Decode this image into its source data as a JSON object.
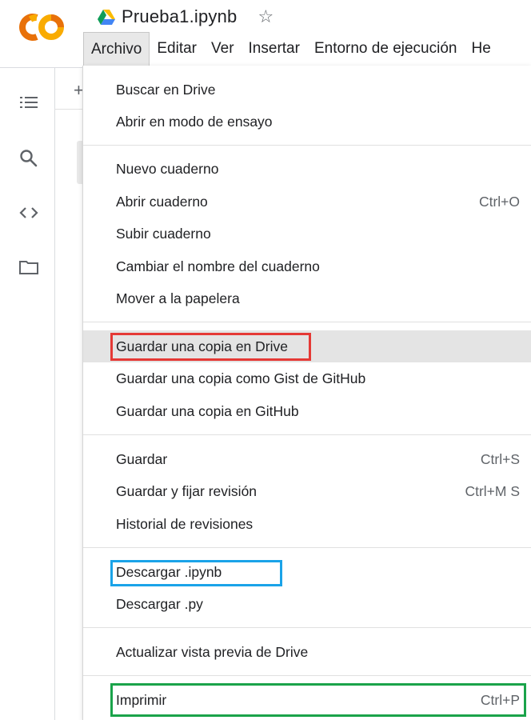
{
  "notebook": {
    "title": "Prueba1.ipynb"
  },
  "menubar": {
    "items": [
      "Archivo",
      "Editar",
      "Ver",
      "Insertar",
      "Entorno de ejecución",
      "He"
    ]
  },
  "file_menu": {
    "items": [
      {
        "label": "Buscar en Drive",
        "shortcut": ""
      },
      {
        "label": "Abrir en modo de ensayo",
        "shortcut": ""
      },
      {
        "label": "Nuevo cuaderno",
        "shortcut": ""
      },
      {
        "label": "Abrir cuaderno",
        "shortcut": "Ctrl+O"
      },
      {
        "label": "Subir cuaderno",
        "shortcut": ""
      },
      {
        "label": "Cambiar el nombre del cuaderno",
        "shortcut": ""
      },
      {
        "label": "Mover a la papelera",
        "shortcut": ""
      },
      {
        "label": "Guardar una copia en Drive",
        "shortcut": ""
      },
      {
        "label": "Guardar una copia como Gist de GitHub",
        "shortcut": ""
      },
      {
        "label": "Guardar una copia en GitHub",
        "shortcut": ""
      },
      {
        "label": "Guardar",
        "shortcut": "Ctrl+S"
      },
      {
        "label": "Guardar y fijar revisión",
        "shortcut": "Ctrl+M S"
      },
      {
        "label": "Historial de revisiones",
        "shortcut": ""
      },
      {
        "label": "Descargar .ipynb",
        "shortcut": ""
      },
      {
        "label": "Descargar .py",
        "shortcut": ""
      },
      {
        "label": "Actualizar vista previa de Drive",
        "shortcut": ""
      },
      {
        "label": "Imprimir",
        "shortcut": "Ctrl+P"
      }
    ]
  },
  "colors": {
    "logo_orange": "#F9AB00",
    "logo_dark_orange": "#E8710A",
    "highlight_red": "#E53935",
    "highlight_blue": "#1AA3E8",
    "highlight_green": "#1AA34A"
  },
  "icons": {
    "sidebar": [
      "table-of-contents-icon",
      "search-icon",
      "code-snippets-icon",
      "folder-icon"
    ]
  }
}
